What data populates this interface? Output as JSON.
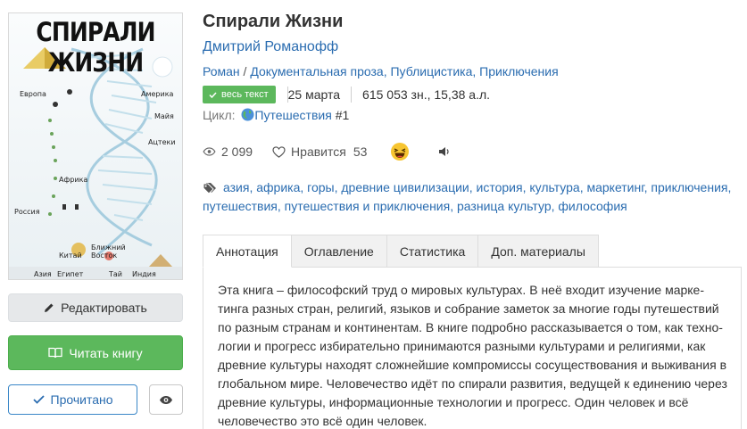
{
  "book": {
    "title": "Спирали Жизни",
    "author": "Дмитрий Романофф",
    "genres": [
      "Роман",
      "Документальная проза, Публицистика, Приключения"
    ],
    "genre_separator": " / ",
    "status_badge": "весь текст",
    "date": "25 марта",
    "size": "615 053 зн., 15,38 а.л.",
    "cycle_label": "Цикл:",
    "cycle_name": "Путешествия",
    "cycle_number": "#1"
  },
  "cover": {
    "title": "СПИРАЛИ ЖИЗНИ",
    "labels": {
      "europe": "Европа",
      "america": "Америка",
      "maya": "Майя",
      "aztecs": "Ацтеки",
      "africa": "Африка",
      "russia": "Россия",
      "near_east": "Ближний Восток",
      "china": "Китай",
      "asia": "Азия",
      "egypt": "Египет",
      "thai": "Тай",
      "india": "Индия"
    }
  },
  "stats": {
    "views": "2 099",
    "likes_label": "Нравится",
    "likes_count": "53"
  },
  "tags": [
    "азия",
    "африка",
    "горы",
    "древние цивилизации",
    "история",
    "культура",
    "маркетинг",
    "приключения",
    "путешествия",
    "путешествия и приключения",
    "разница культур",
    "философия"
  ],
  "actions": {
    "edit": "Редактировать",
    "read": "Читать книгу",
    "done": "Прочитано"
  },
  "tabs": [
    "Аннотация",
    "Оглавление",
    "Статистика",
    "Доп. материалы"
  ],
  "annotation": "Эта книга – философский труд о мировых культурах. В неё входит изучение марке­тинга разных стран, религий, языков и собрание заметок за многие годы путешествий по разным странам и континентам. В книге подробно рассказывается о том, как техно­логии и прогресс избирательно принимаются разными культурами и религиями, как древние культуры находят сложнейшие компромиссы сосуществования и выживания в глобальном мире. Человечество идёт по спирали развития, ведущей к единению че­рез древние культуры, информационные технологии и прогресс. Один человек и всё человечество это всё один человек.",
  "colors": {
    "link": "#2a6cb0",
    "success": "#5cb85c",
    "muted_button": "#e6e8ea"
  }
}
